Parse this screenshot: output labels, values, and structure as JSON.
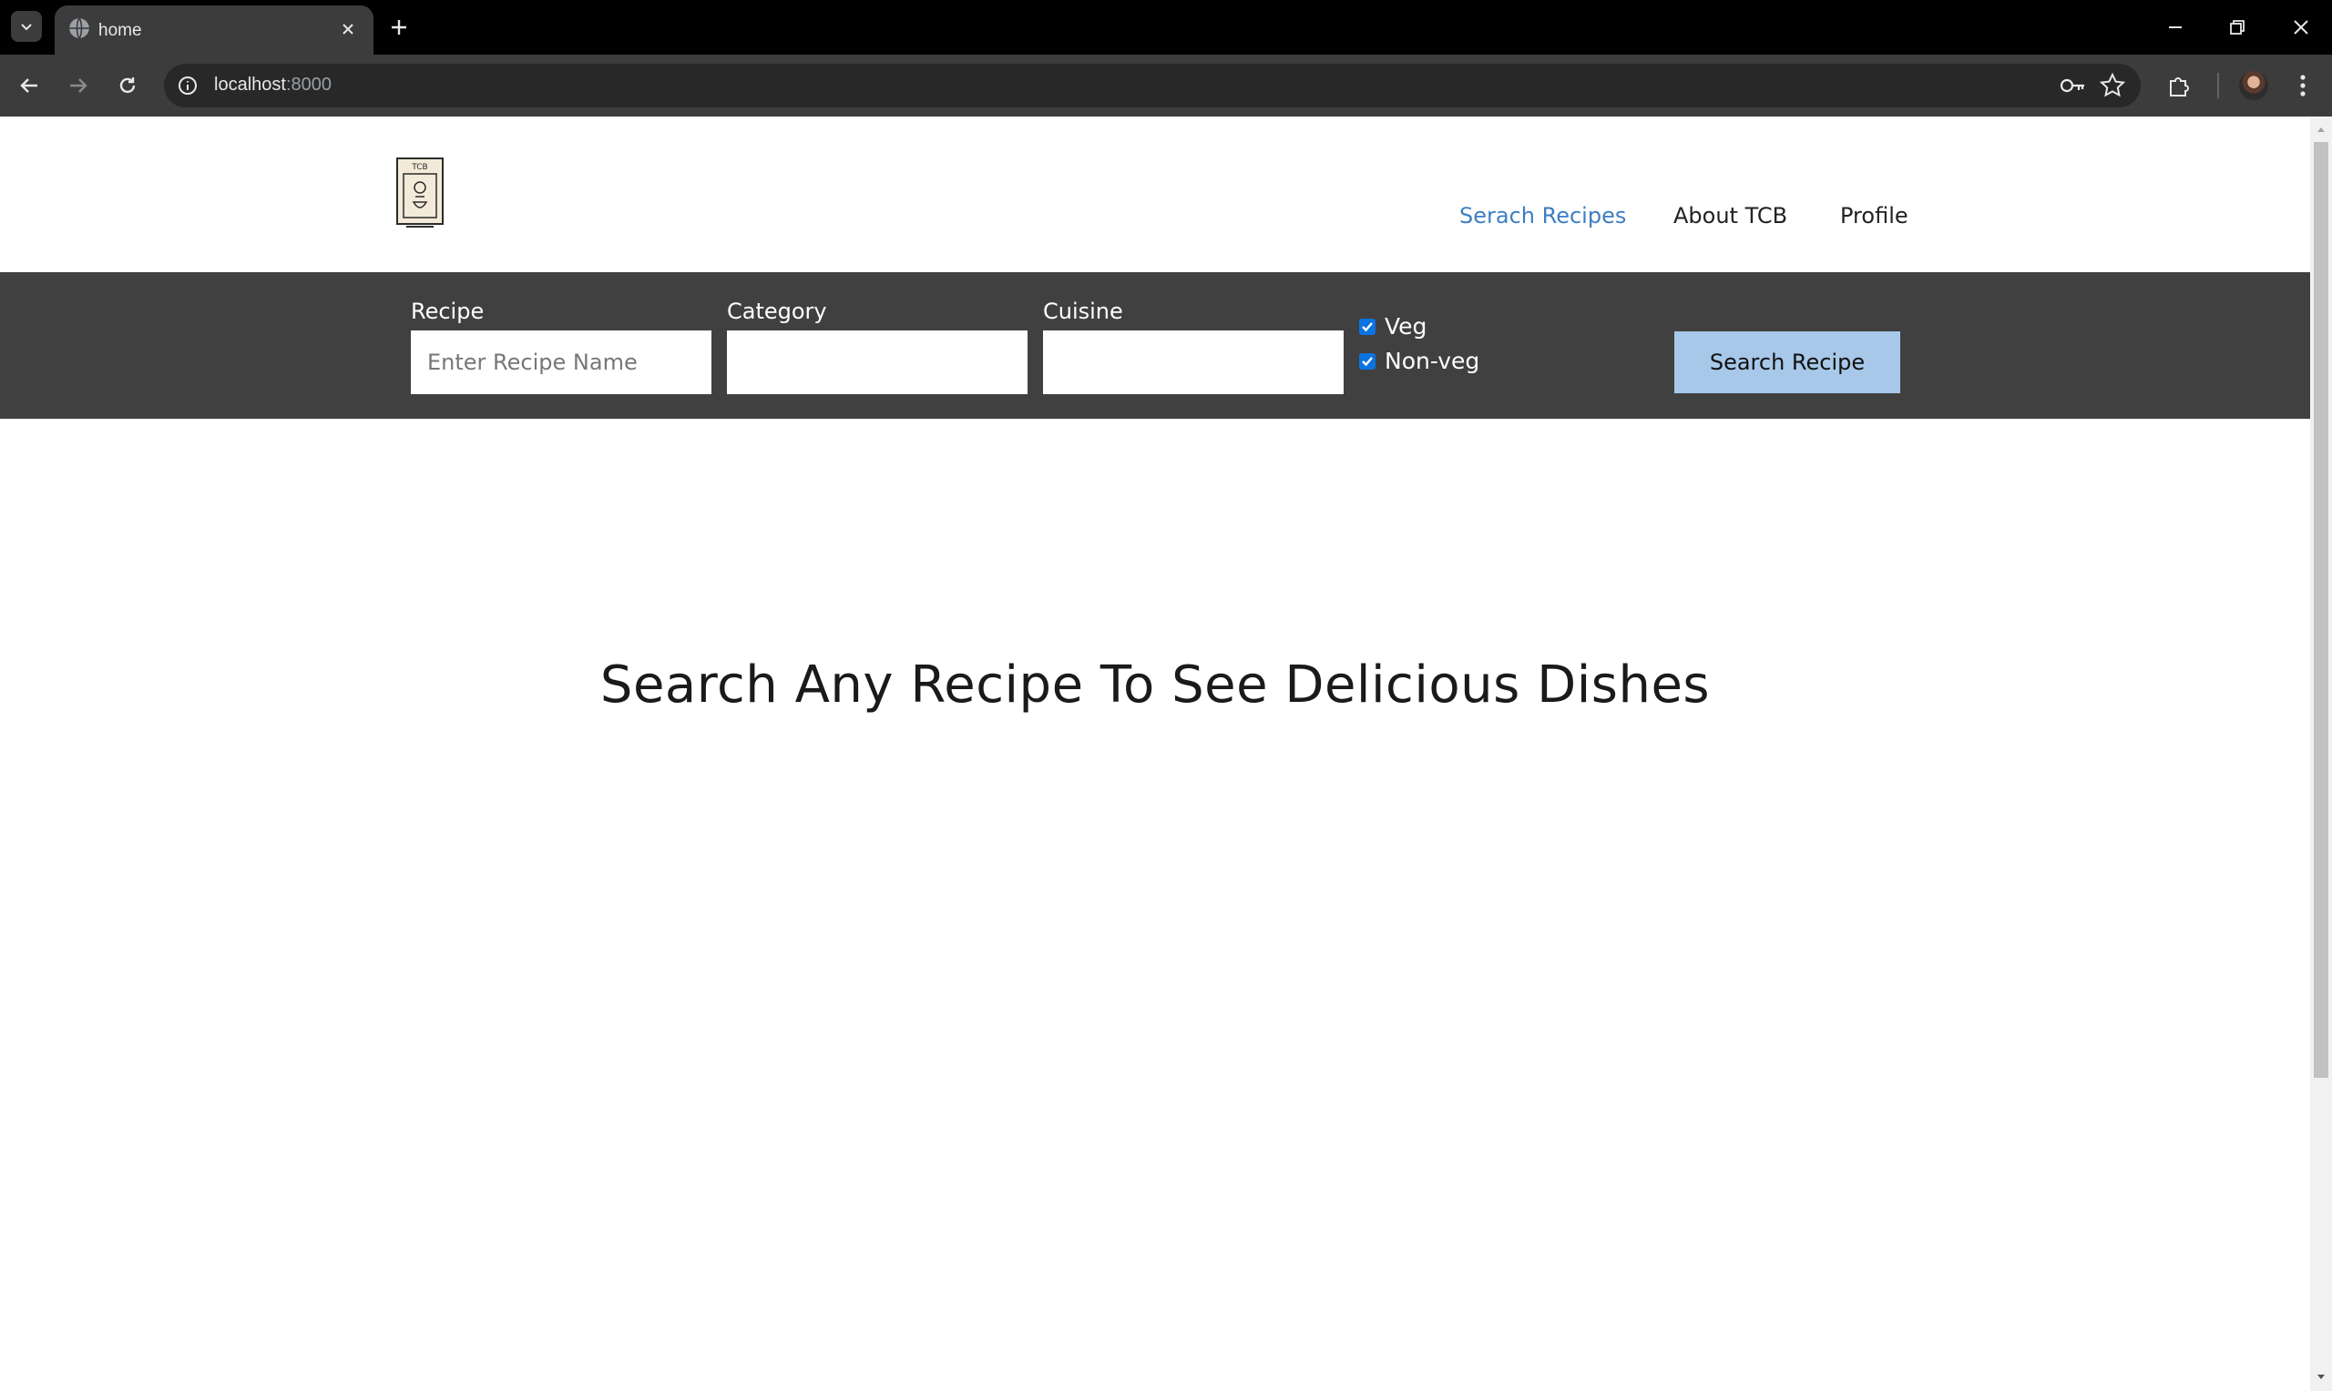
{
  "browser": {
    "tab_title": "home",
    "url_host": "localhost",
    "url_port": ":8000"
  },
  "nav": {
    "items": [
      {
        "label": "Serach Recipes",
        "active": true
      },
      {
        "label": "About TCB"
      },
      {
        "label": "Profile"
      }
    ]
  },
  "logo": {
    "text": "TCB"
  },
  "search": {
    "recipe_label": "Recipe",
    "recipe_placeholder": "Enter Recipe Name",
    "category_label": "Category",
    "category_value": "",
    "cuisine_label": "Cuisine",
    "cuisine_value": "",
    "veg_label": "Veg",
    "veg_checked": true,
    "nonveg_label": "Non-veg",
    "nonveg_checked": true,
    "button_label": "Search Recipe"
  },
  "hero": {
    "text": "Search Any Recipe To See Delicious Dishes"
  },
  "colors": {
    "accent": "#3f7ec1",
    "search_bg": "#404040",
    "button_bg": "#a7c8e8"
  }
}
